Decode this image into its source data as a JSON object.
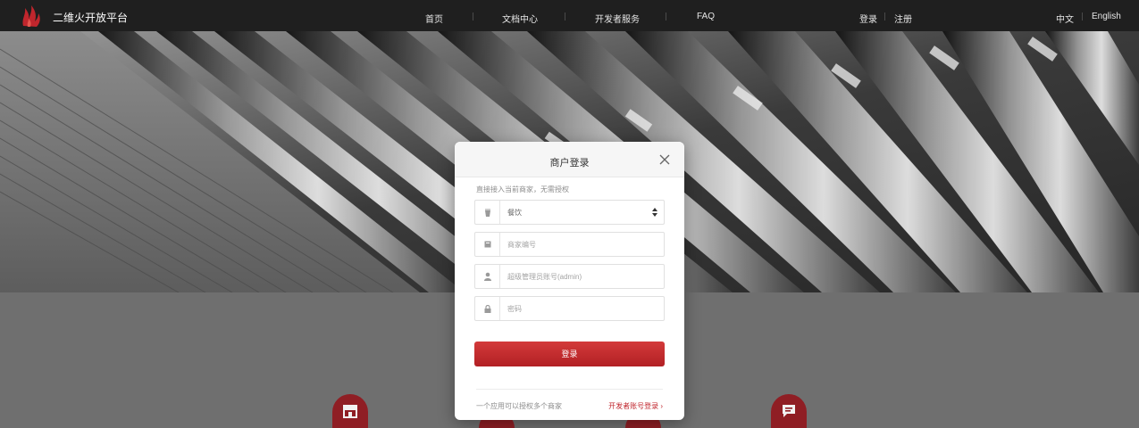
{
  "header": {
    "brand": "二维火开放平台",
    "nav": [
      "首页",
      "文档中心",
      "开发者服务",
      "FAQ"
    ],
    "auth": {
      "login": "登录",
      "register": "注册"
    },
    "lang": {
      "zh": "中文",
      "en": "English"
    }
  },
  "modal": {
    "title": "商户登录",
    "hint": "直接接入当前商家，无需授权",
    "fields": {
      "industry_value": "餐饮",
      "merchant_placeholder": "商家编号",
      "admin_placeholder": "超级管理员账号(admin)",
      "password_placeholder": "密码"
    },
    "submit_label": "登录",
    "footer_note": "一个应用可以授权多个商家",
    "developer_link": "开发者账号登录 ›"
  },
  "colors": {
    "accent": "#c0262d",
    "topbar": "#1f1f1f",
    "feature_icon": "#8f1e24"
  },
  "icons": [
    "logo-flame-icon",
    "close-icon",
    "cup-icon",
    "card-icon",
    "user-icon",
    "lock-icon",
    "store-icon",
    "message-icon"
  ]
}
